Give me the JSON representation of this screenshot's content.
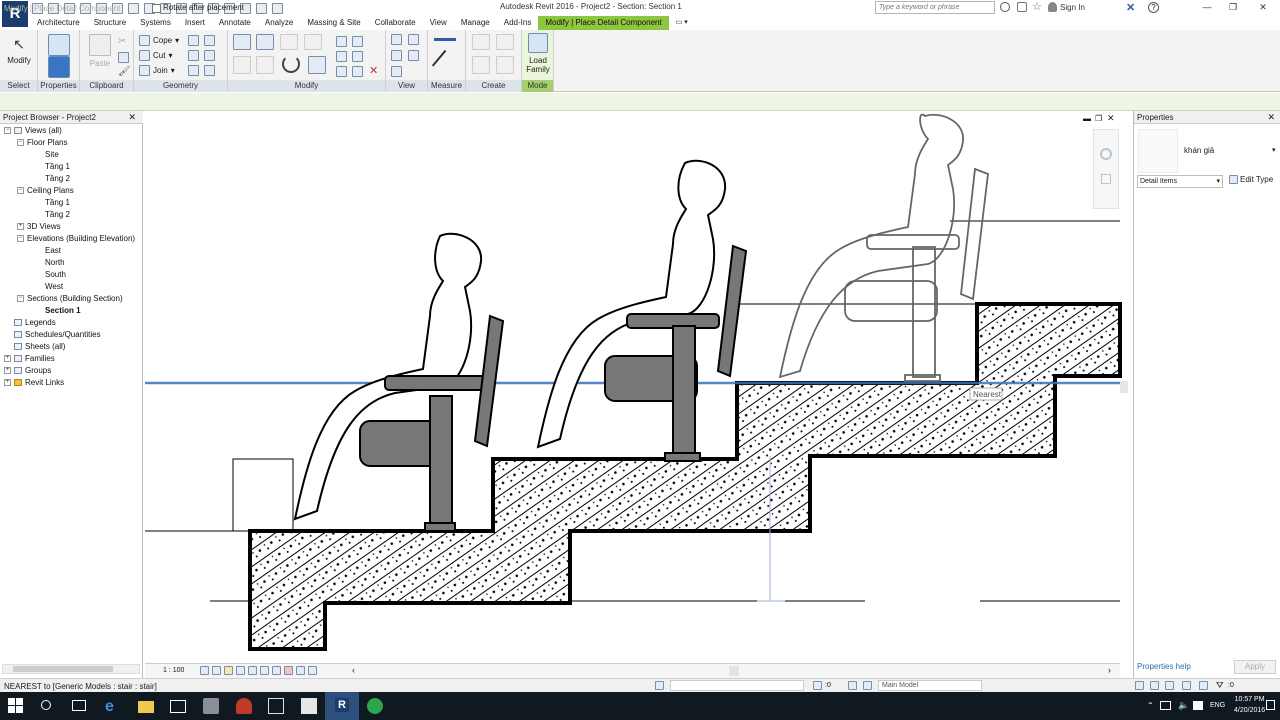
{
  "titlebar": {
    "title": "Autodesk Revit 2016 -     Project2 - Section: Section 1",
    "search_placeholder": "Type a keyword or phrase",
    "sign_in": "Sign In",
    "app_letter": "R"
  },
  "tabs": [
    {
      "label": "Architecture"
    },
    {
      "label": "Structure"
    },
    {
      "label": "Systems"
    },
    {
      "label": "Insert"
    },
    {
      "label": "Annotate"
    },
    {
      "label": "Analyze"
    },
    {
      "label": "Massing & Site"
    },
    {
      "label": "Collaborate"
    },
    {
      "label": "View"
    },
    {
      "label": "Manage"
    },
    {
      "label": "Add-Ins"
    },
    {
      "label": "Modify | Place Detail Component"
    }
  ],
  "ribbon": {
    "modify_label": "Modify",
    "panels": {
      "select": "Select",
      "properties": "Properties",
      "clipboard": "Clipboard",
      "geometry": "Geometry",
      "modify": "Modify",
      "view": "View",
      "measure": "Measure",
      "create": "Create",
      "mode": "Mode"
    },
    "paste_label": "Paste",
    "cope_label": "Cope",
    "cut_label": "Cut",
    "join_label": "Join",
    "load_family_label": "Load\nFamily"
  },
  "options_bar": {
    "context": "Modify | Place Detail Component",
    "rotate_label": "Rotate after placement"
  },
  "project_browser": {
    "title": "Project Browser - Project2",
    "items": [
      {
        "label": "Views (all)"
      },
      {
        "label": "Floor Plans"
      },
      {
        "label": "Site"
      },
      {
        "label": "Tầng 1"
      },
      {
        "label": "Tầng 2"
      },
      {
        "label": "Ceiling Plans"
      },
      {
        "label": "Tầng 1"
      },
      {
        "label": "Tầng 2"
      },
      {
        "label": "3D Views"
      },
      {
        "label": "Elevations (Building Elevation)"
      },
      {
        "label": "East"
      },
      {
        "label": "North"
      },
      {
        "label": "South"
      },
      {
        "label": "West"
      },
      {
        "label": "Sections (Building Section)"
      },
      {
        "label": "Section 1"
      },
      {
        "label": "Legends"
      },
      {
        "label": "Schedules/Quantities"
      },
      {
        "label": "Sheets (all)"
      },
      {
        "label": "Families"
      },
      {
        "label": "Groups"
      },
      {
        "label": "Revit Links"
      }
    ]
  },
  "view": {
    "scale": "1 : 100",
    "snap_tooltip": "Nearest"
  },
  "properties": {
    "title": "Properties",
    "type_name": "khán giả",
    "category": "Detail Items",
    "edit_type": "Edit Type",
    "help": "Properties help",
    "apply": "Apply"
  },
  "status": {
    "text": "NEAREST  to [Generic Models : stair : stair]",
    "workset_value": ":0",
    "model": "Main Model",
    "filter_count": ":0"
  },
  "taskbar": {
    "lang": "ENG",
    "time": "10:57 PM",
    "date": "4/20/2016"
  },
  "colors": {
    "accent_green": "#8dc63f",
    "revit_blue": "#1b3d6e",
    "taskbar": "#101820",
    "workplane_line": "#3b6fbf"
  }
}
